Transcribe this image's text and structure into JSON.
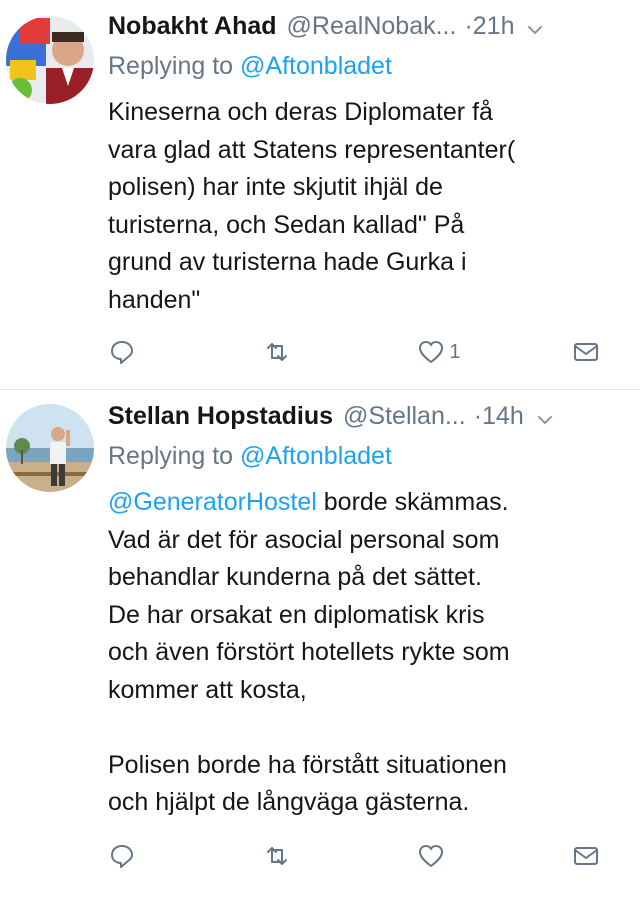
{
  "tweets": [
    {
      "name": "Nobakht Ahad",
      "handle": "@RealNobak...",
      "time": "·21h",
      "reply_prefix": "Replying to",
      "reply_to": "@Aftonbladet",
      "text_mention": "",
      "text": "Kineserna och deras Diplomater få\nvara glad att Statens representanter(\npolisen) har inte skjutit ihjäl de\nturisterna, och Sedan kallad\" På\ngrund av turisterna hade Gurka i\nhanden\"",
      "actions": {
        "reply_icon": "reply-icon",
        "retweet_icon": "retweet-icon",
        "like_icon": "heart-icon",
        "like_count": "1",
        "dm_icon": "mail-icon"
      }
    },
    {
      "name": "Stellan Hopstadius",
      "handle": "@Stellan...",
      "time": "·14h",
      "reply_prefix": "Replying to",
      "reply_to": "@Aftonbladet",
      "text_mention": "@GeneratorHostel",
      "text": " borde skämmas.\nVad är det för asocial personal som\nbehandlar kunderna på det sättet.\nDe har orsakat en diplomatisk kris\noch även förstört hotellets rykte som\nkommer att kosta,\n\nPolisen borde ha förstått situationen\noch hjälpt de långväga gästerna.",
      "actions": {
        "reply_icon": "reply-icon",
        "retweet_icon": "retweet-icon",
        "like_icon": "heart-icon",
        "like_count": "",
        "dm_icon": "mail-icon"
      }
    }
  ],
  "colors": {
    "link": "#1da1f2",
    "muted": "#657786",
    "text": "#14171a",
    "divider": "#e1e8ed"
  }
}
